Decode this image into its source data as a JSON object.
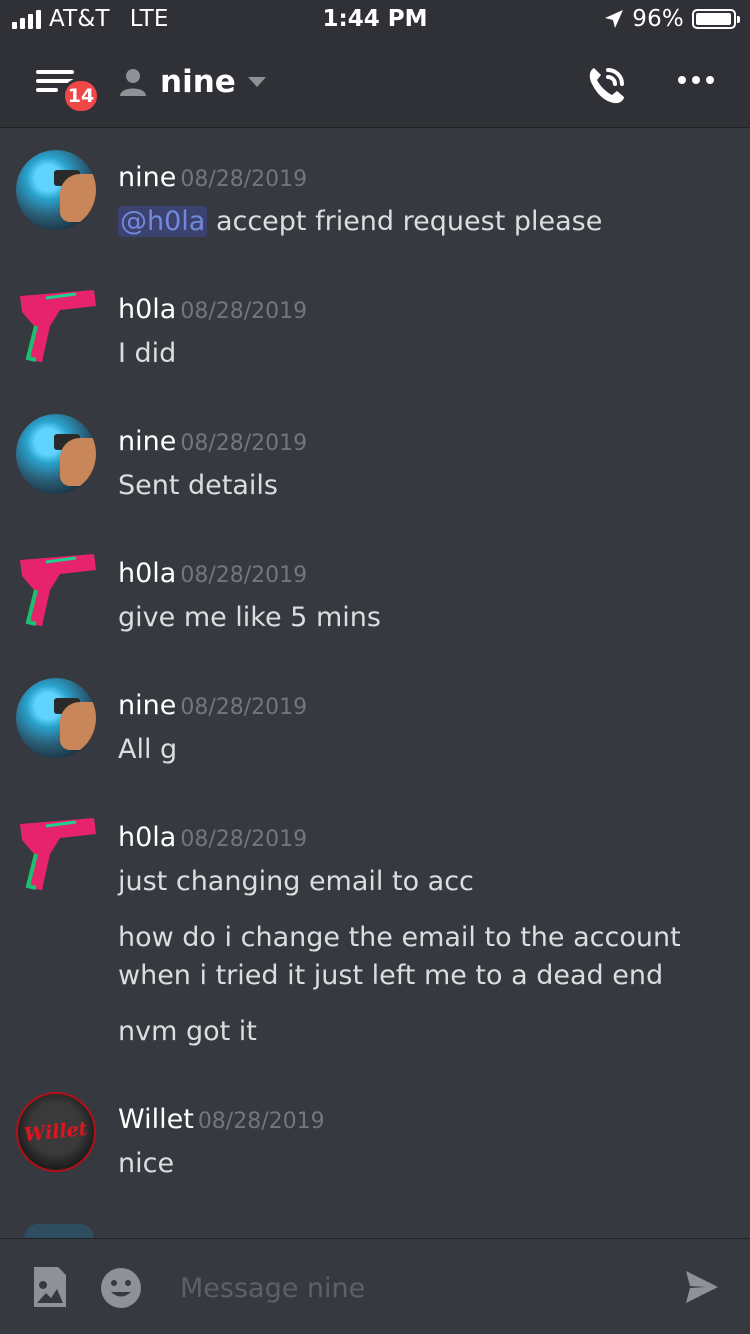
{
  "status_bar": {
    "carrier": "AT&T",
    "network": "LTE",
    "time": "1:44 PM",
    "battery": "96%",
    "battery_level": 0.96,
    "icons": [
      "signal-icon",
      "location-arrow-icon",
      "battery-icon"
    ]
  },
  "header": {
    "unread_badge": "14",
    "channel_name": "nine",
    "icons": [
      "hamburger-menu-icon",
      "person-icon",
      "caret-down-icon",
      "call-icon",
      "more-icon"
    ]
  },
  "messages": [
    {
      "author": "nine",
      "timestamp": "08/28/2019",
      "avatar": "nine",
      "mention": "@h0la",
      "lines": [
        "accept friend request please"
      ]
    },
    {
      "author": "h0la",
      "timestamp": "08/28/2019",
      "avatar": "h0la",
      "lines": [
        "I did"
      ]
    },
    {
      "author": "nine",
      "timestamp": "08/28/2019",
      "avatar": "nine",
      "lines": [
        "Sent details"
      ]
    },
    {
      "author": "h0la",
      "timestamp": "08/28/2019",
      "avatar": "h0la",
      "lines": [
        "give me like 5 mins"
      ]
    },
    {
      "author": "nine",
      "timestamp": "08/28/2019",
      "avatar": "nine",
      "lines": [
        "All g"
      ]
    },
    {
      "author": "h0la",
      "timestamp": "08/28/2019",
      "avatar": "h0la",
      "lines": [
        "just changing email to acc",
        "how do i change the email to the account when i tried it just left me to a dead end",
        "nvm got it"
      ]
    },
    {
      "author": "Willet",
      "timestamp": "08/28/2019",
      "avatar": "Willet",
      "avatar_text": "Willet",
      "lines": [
        "nice"
      ]
    }
  ],
  "composer": {
    "placeholder": "Message nine",
    "icons": [
      "image-upload-icon",
      "emoji-icon",
      "send-icon"
    ]
  },
  "colors": {
    "background": "#36393f",
    "header": "#2f3136",
    "badge": "#f04747",
    "mention": "#7289da",
    "timestamp": "#72767d"
  }
}
